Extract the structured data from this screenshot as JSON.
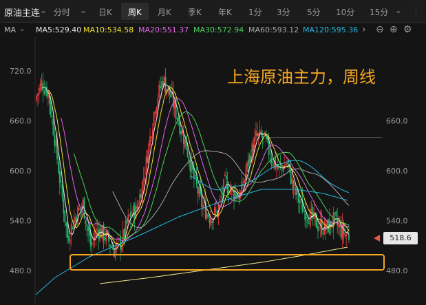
{
  "header": {
    "title": "原油主连",
    "tabs": [
      "分时",
      "日K",
      "周K",
      "月K",
      "季K",
      "年K",
      "1分",
      "3分",
      "5分",
      "10分",
      "15分"
    ],
    "active_tab": "周K"
  },
  "ma_bar": {
    "prefix": "MA",
    "items": [
      {
        "label": "MA5:529.40",
        "color": "#e6e6e6"
      },
      {
        "label": "MA10:534.58",
        "color": "#f2e12f"
      },
      {
        "label": "MA20:551.37",
        "color": "#e266e8"
      },
      {
        "label": "MA30:572.94",
        "color": "#4fd25a"
      },
      {
        "label": "MA60:593.12",
        "color": "#a8a8a8"
      },
      {
        "label": "MA120:595.36",
        "color": "#27b8e0"
      }
    ]
  },
  "axis": {
    "left_ticks": [
      "720.0",
      "660.0",
      "600.0",
      "540.0",
      "480.0"
    ],
    "right_ticks": [
      "660.0",
      "600.0",
      "540.0",
      "480.0"
    ]
  },
  "current_price": "518.6",
  "annotation": "上海原油主力，周线",
  "colors": {
    "up": "#e23b3b",
    "down": "#1fb36b",
    "highlight": "#f5a623",
    "background": "#141414"
  }
}
